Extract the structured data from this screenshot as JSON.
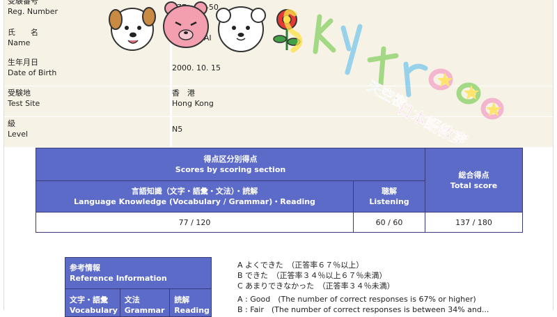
{
  "info_rows": [
    {
      "label_jp": "受験番号",
      "label_en": "Reg. Number",
      "value": "17E····03-50"
    },
    {
      "label_jp": "氏　　名",
      "label_en": "Name",
      "value": "···LAI"
    },
    {
      "label_jp": "生年月日",
      "label_en": "Date of Birth",
      "value": "2000. 10. 15"
    },
    {
      "label_jp": "受験地",
      "label_en": "Test Site",
      "value_jp": "香　港",
      "value_en": "Hong Kong"
    },
    {
      "label_jp": "級",
      "label_en": "Level",
      "value": "N5"
    }
  ],
  "score_table": {
    "section_header_jp": "得点区分別得点",
    "section_header_en": "Scores by scoring section",
    "language_jp": "言語知識（文字・語彙・文法）・読解",
    "language_en": "Language Knowledge (Vocabulary / Grammar)・Reading",
    "listening_jp": "聴解",
    "listening_en": "Listening",
    "total_jp": "総合得点",
    "total_en": "Total score",
    "language_score": "77 / 120",
    "listening_score": "60 / 60",
    "total_score": "137 / 180"
  },
  "reference": {
    "header_jp": "参考情報",
    "header_en": "Reference Information",
    "cols": [
      {
        "jp": "文字・語彙",
        "en": "Vocabulary"
      },
      {
        "jp": "文法",
        "en": "Grammar"
      },
      {
        "jp": "読解",
        "en": "Reading"
      }
    ]
  },
  "legend_lines": [
    "A よくできた　（正答率６７％以上）",
    "B できた　（正答率３４％以上６７％未満）",
    "C あまりできなかった　（正答率３４％未満）",
    "A : Good　(The number of correct responses is 67% or higher)",
    "B : Fair　(The number of correct responses is between 34% and..."
  ],
  "watermark": {
    "brand_en": "Sky Tree",
    "brand_jp": "天空樹日本語教室"
  },
  "colors": {
    "header_blue": "#5c6bc8",
    "info_bg": "#f7f2e6",
    "wm_green": "#8cd36a",
    "wm_pink": "#f3a6c8",
    "wm_blue": "#7ec8ec",
    "wm_yellow": "#ffe14a"
  }
}
